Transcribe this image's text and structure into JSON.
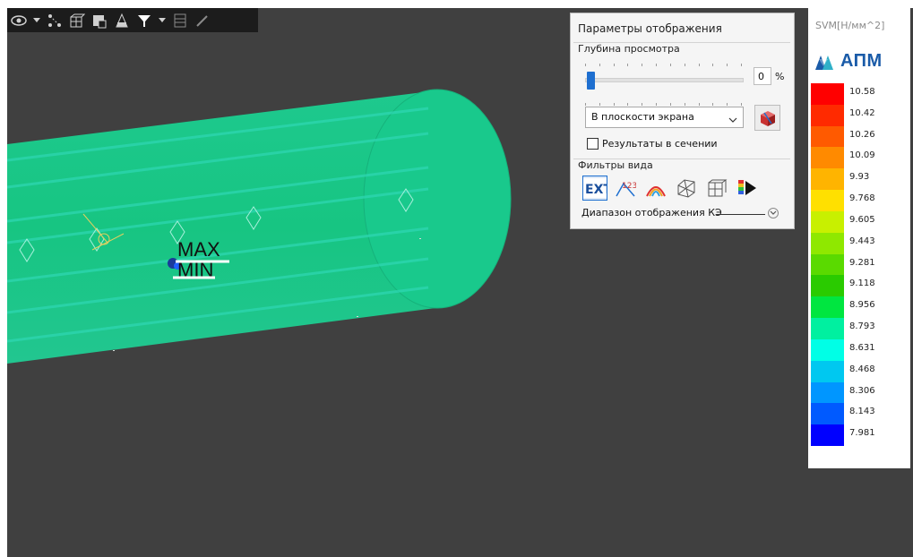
{
  "toolbar": {
    "icons": [
      "view-eye-icon",
      "dropdown-arrow-icon",
      "node-link-icon",
      "grid-cube-icon",
      "render-mode-icon",
      "section-view-icon",
      "filter-funnel-icon",
      "dropdown-arrow-icon",
      "table-icon",
      "eyedropper-icon"
    ]
  },
  "viewport": {
    "max_label": "MAX",
    "min_label": "MIN"
  },
  "params_panel": {
    "title": "Параметры отображения",
    "depth_group_label": "Глубина просмотра",
    "depth_value": "0",
    "depth_fraction": 0.0,
    "percent_sign": "%",
    "plane_select_value": "В плоскости экрана",
    "section_results_label": "Результаты в сечении",
    "section_results_checked": false,
    "filters_group_label": "Фильтры вида",
    "filter_icons": [
      "ext-filter-icon",
      "numbers-123-icon",
      "isolines-icon",
      "mesh-icon",
      "mesh-grid-icon",
      "color-scale-play-icon"
    ],
    "range_label": "Диапазон отображения КЭ"
  },
  "legend": {
    "title": "SVM[Н/мм^2]",
    "logo_text": "АПМ",
    "labels": [
      "10.58",
      "10.42",
      "10.26",
      "10.09",
      "9.93",
      "9.768",
      "9.605",
      "9.443",
      "9.281",
      "9.118",
      "8.956",
      "8.793",
      "8.631",
      "8.468",
      "8.306",
      "8.143",
      "7.981"
    ],
    "colors": [
      "#ff0000",
      "#ff2a00",
      "#ff5a00",
      "#ff8a00",
      "#ffb400",
      "#ffe000",
      "#c8f000",
      "#8fe800",
      "#5ada00",
      "#2acb00",
      "#00e640",
      "#00f0a0",
      "#00ffe6",
      "#00c8f0",
      "#0096ff",
      "#005aff",
      "#0000ff"
    ]
  }
}
